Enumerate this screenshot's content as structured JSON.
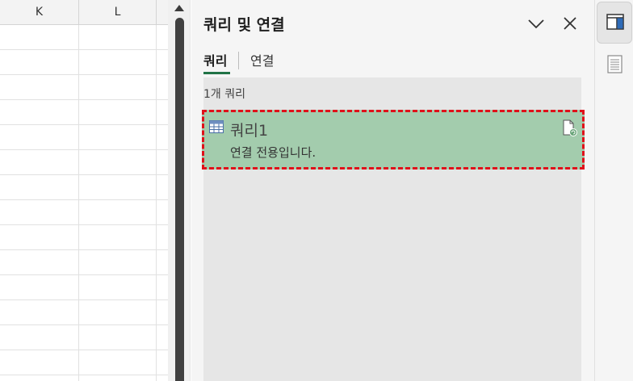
{
  "sheet": {
    "columns": [
      "K",
      "L"
    ]
  },
  "pane": {
    "title": "쿼리 및 연결",
    "tabs": [
      {
        "label": "쿼리",
        "active": true
      },
      {
        "label": "연결",
        "active": false
      }
    ],
    "query_count": "1개 쿼리",
    "queries": [
      {
        "name": "쿼리1",
        "description": "연결 전용입니다.",
        "selected": true
      }
    ]
  },
  "icons": {
    "collapse": "chevron-down-icon",
    "close": "close-icon",
    "query_type": "table-icon",
    "query_status": "file-refresh-icon",
    "strip_primary": "panel-layout-icon",
    "strip_secondary": "document-list-icon"
  },
  "colors": {
    "accent": "#217346",
    "selected_item": "#a3ccad",
    "highlight_border": "#e0101a"
  }
}
